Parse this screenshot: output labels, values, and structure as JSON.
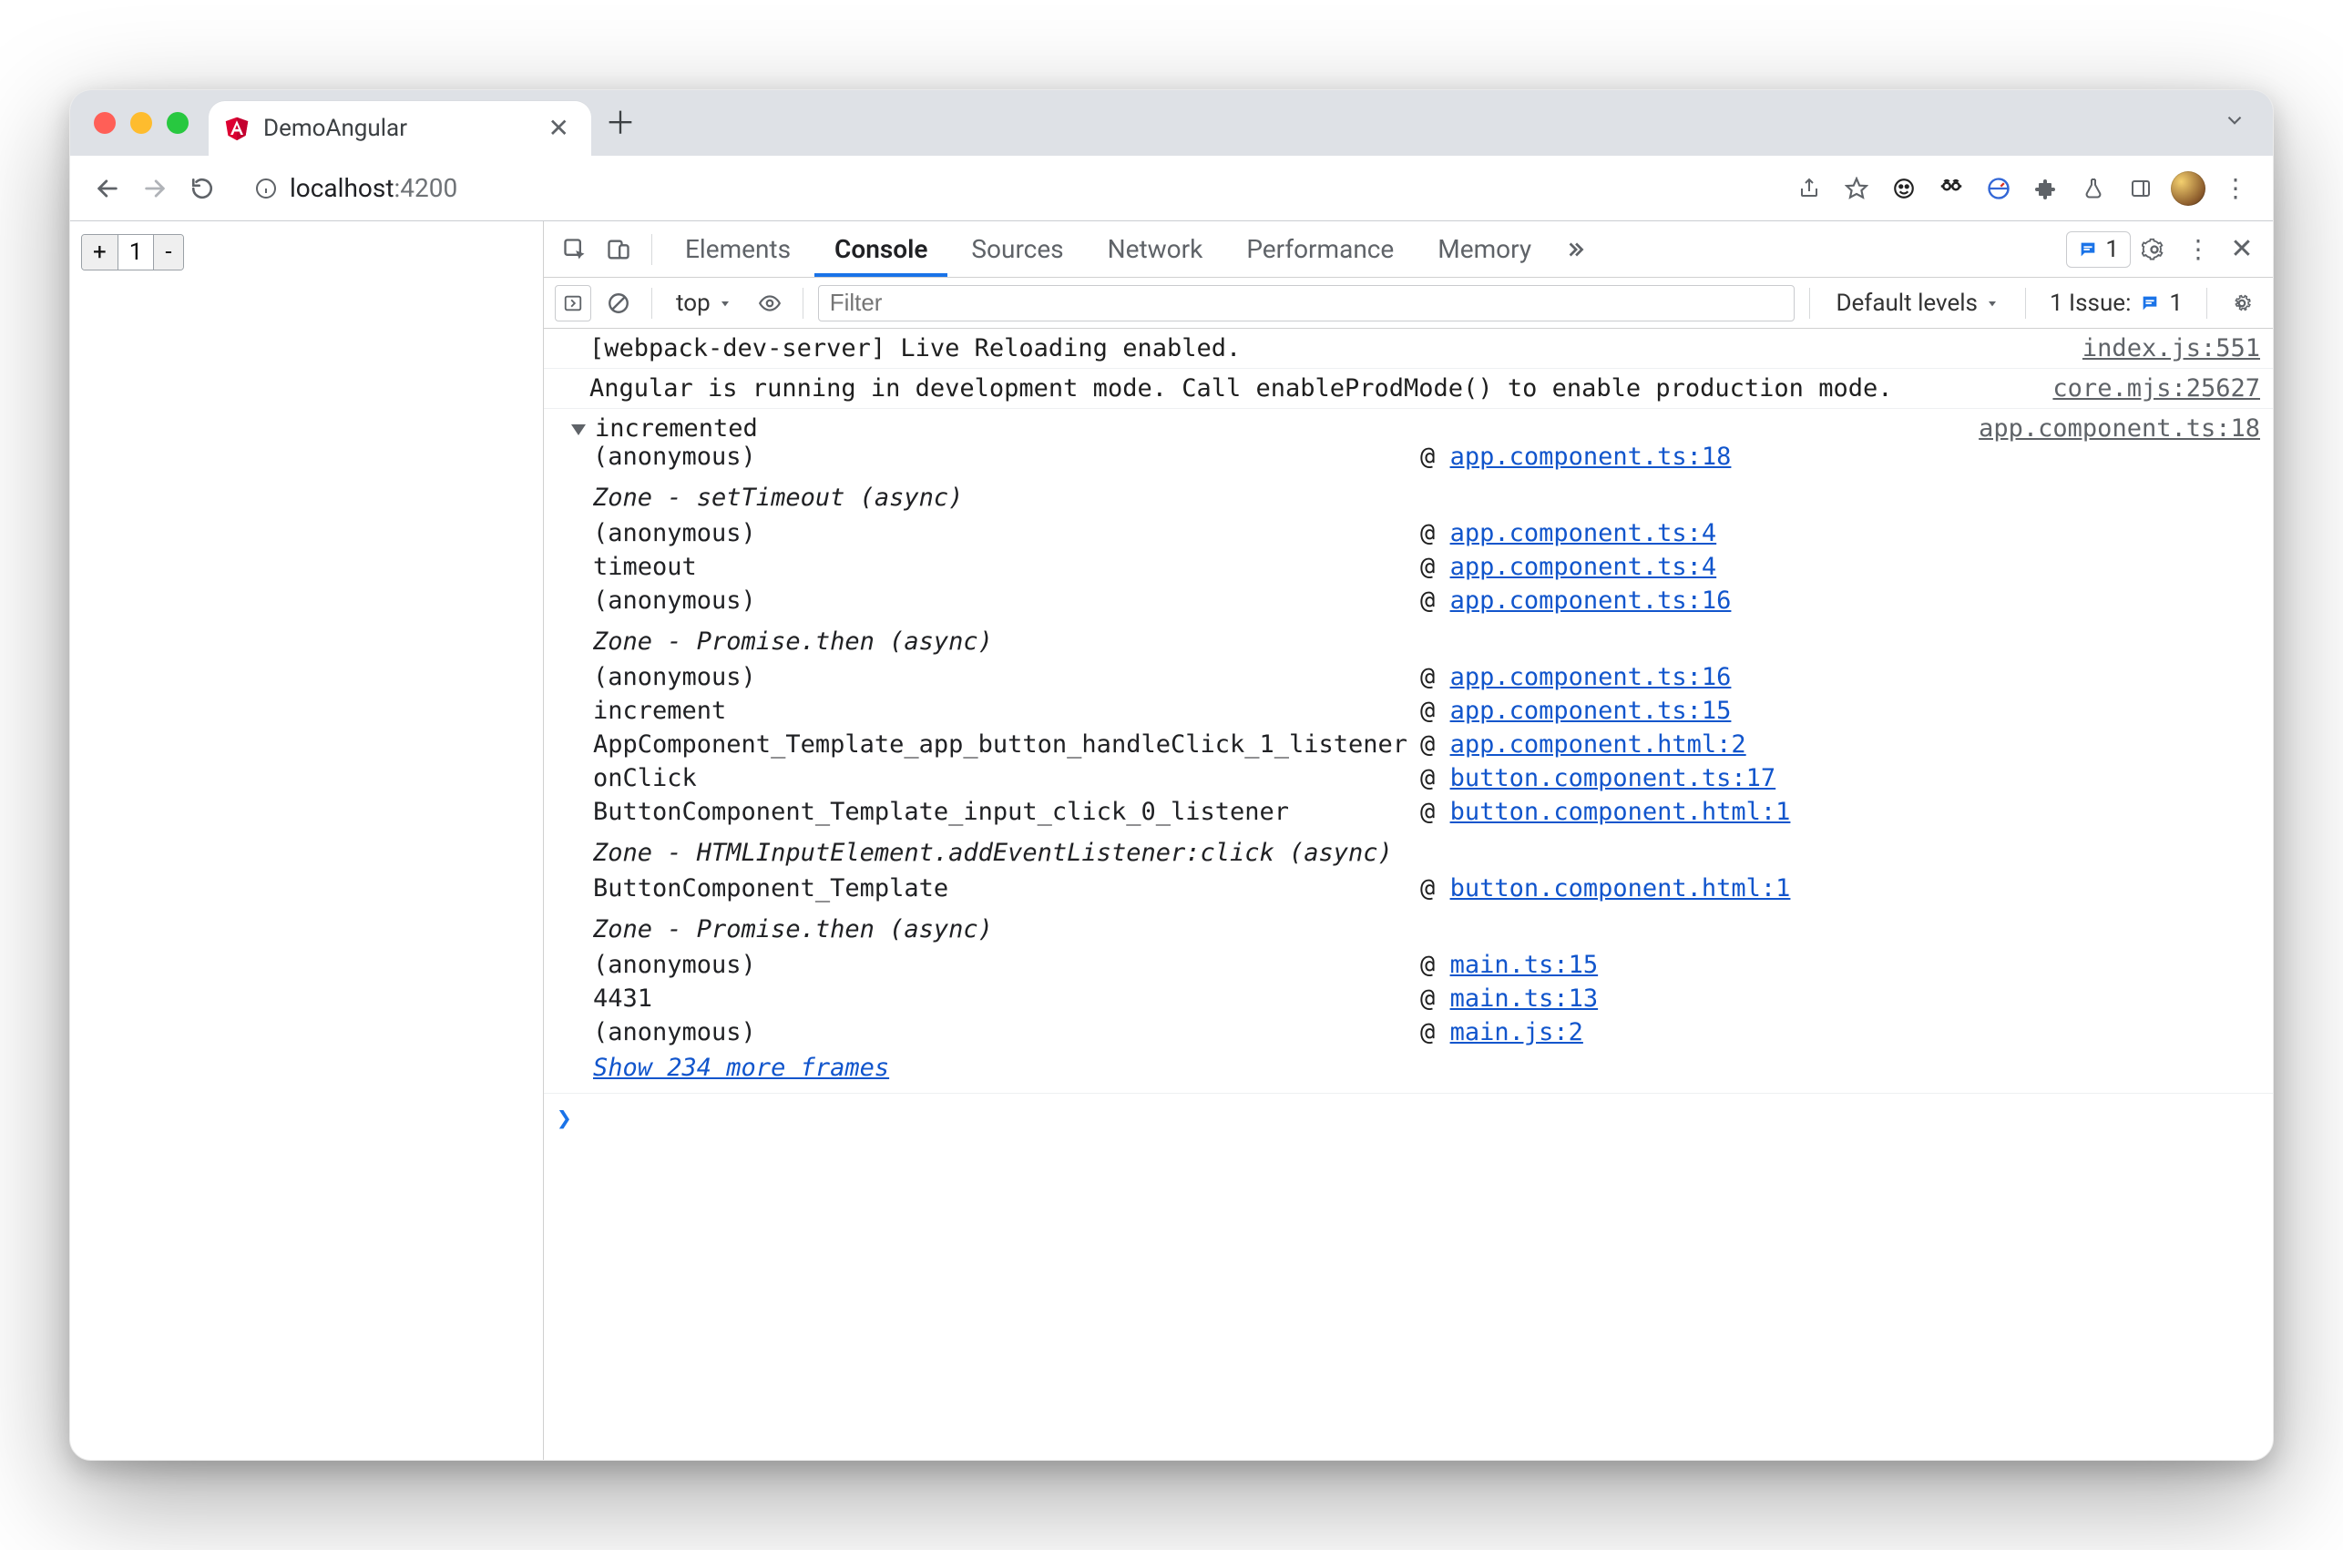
{
  "browser": {
    "tab_title": "DemoAngular",
    "url_host": "localhost",
    "url_port": ":4200"
  },
  "page": {
    "counter_value": "1",
    "plus": "+",
    "minus": "-"
  },
  "devtools": {
    "tabs": {
      "elements": "Elements",
      "console": "Console",
      "sources": "Sources",
      "network": "Network",
      "performance": "Performance",
      "memory": "Memory"
    },
    "messages_count": "1",
    "subbar": {
      "context": "top",
      "filter_placeholder": "Filter",
      "levels": "Default levels",
      "issue_label": "1 Issue:",
      "issue_count": "1"
    },
    "logs": [
      {
        "msg": "[webpack-dev-server] Live Reloading enabled.",
        "src": "index.js:551"
      },
      {
        "msg": "Angular is running in development mode. Call enableProdMode() to enable production mode.",
        "src": "core.mjs:25627"
      }
    ],
    "trace": {
      "title": "incremented",
      "src": "app.component.ts:18",
      "show_more": "Show 234 more frames",
      "frames": [
        {
          "fn": "(anonymous)",
          "loc": "app.component.ts:18"
        },
        {
          "fn": "Zone - setTimeout (async)",
          "async": true
        },
        {
          "fn": "(anonymous)",
          "loc": "app.component.ts:4"
        },
        {
          "fn": "timeout",
          "loc": "app.component.ts:4"
        },
        {
          "fn": "(anonymous)",
          "loc": "app.component.ts:16"
        },
        {
          "fn": "Zone - Promise.then (async)",
          "async": true
        },
        {
          "fn": "(anonymous)",
          "loc": "app.component.ts:16"
        },
        {
          "fn": "increment",
          "loc": "app.component.ts:15"
        },
        {
          "fn": "AppComponent_Template_app_button_handleClick_1_listener",
          "loc": "app.component.html:2"
        },
        {
          "fn": "onClick",
          "loc": "button.component.ts:17"
        },
        {
          "fn": "ButtonComponent_Template_input_click_0_listener",
          "loc": "button.component.html:1"
        },
        {
          "fn": "Zone - HTMLInputElement.addEventListener:click (async)",
          "async": true
        },
        {
          "fn": "ButtonComponent_Template",
          "loc": "button.component.html:1"
        },
        {
          "fn": "Zone - Promise.then (async)",
          "async": true
        },
        {
          "fn": "(anonymous)",
          "loc": "main.ts:15"
        },
        {
          "fn": "4431",
          "loc": "main.ts:13"
        },
        {
          "fn": "(anonymous)",
          "loc": "main.js:2"
        }
      ]
    }
  }
}
